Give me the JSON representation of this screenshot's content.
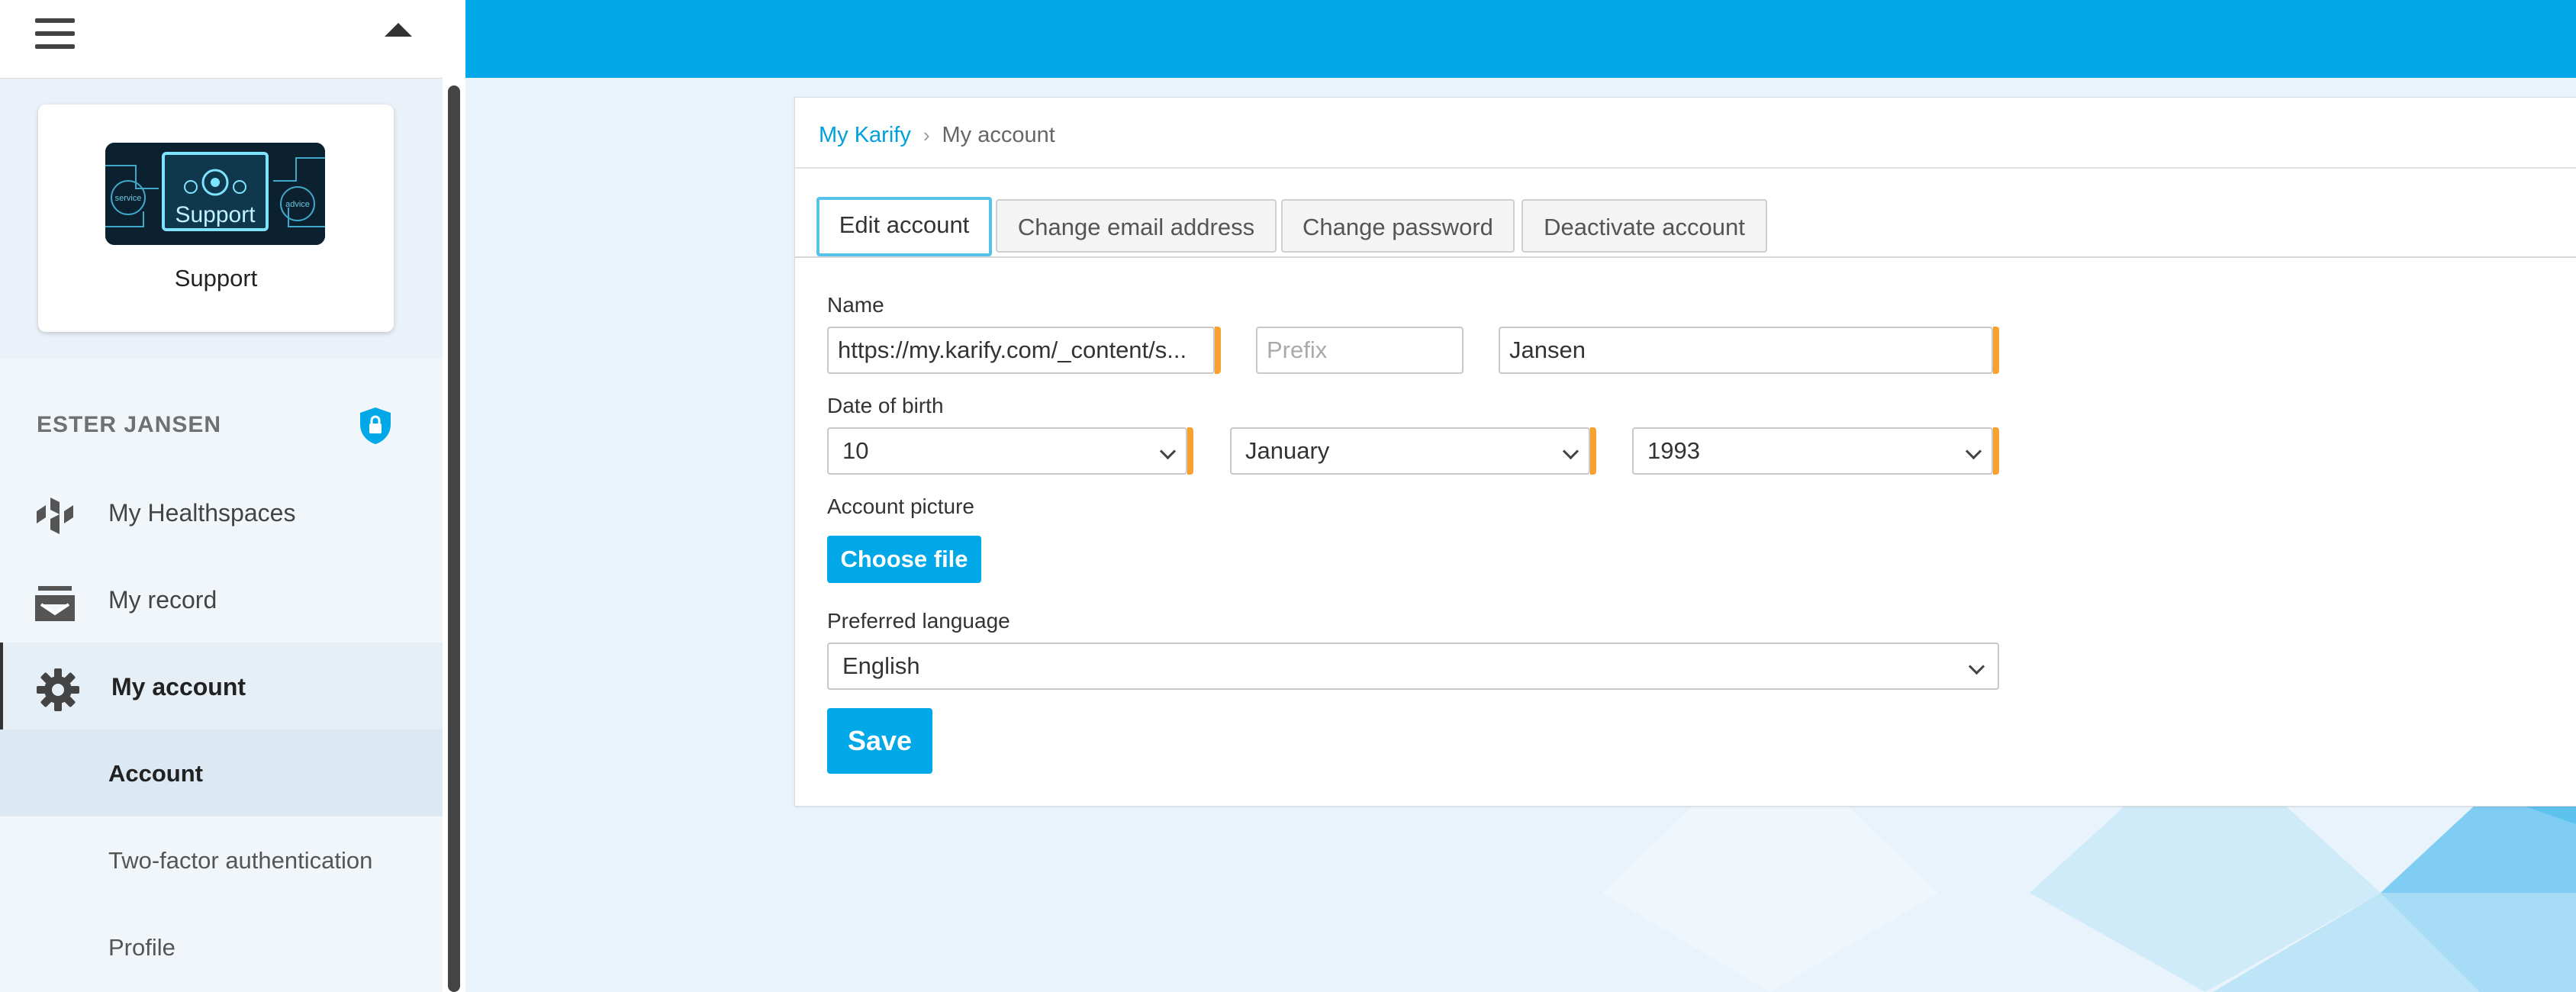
{
  "sidebar": {
    "support_card": {
      "name": "Support",
      "logo_text": "Support",
      "logo_small_left": "service",
      "logo_small_right": "advice"
    },
    "user": {
      "name": "ESTER JANSEN"
    },
    "nav": [
      {
        "label": "My Healthspaces",
        "icon": "healthspaces-icon"
      },
      {
        "label": "My record",
        "icon": "inbox-icon"
      },
      {
        "label": "My account",
        "icon": "gear-icon"
      }
    ],
    "subnav": [
      {
        "label": "Account"
      },
      {
        "label": "Two-factor authentication"
      },
      {
        "label": "Profile"
      }
    ]
  },
  "breadcrumb": {
    "root": "My Karify",
    "separator": "›",
    "current": "My account"
  },
  "tabs": [
    {
      "label": "Edit account"
    },
    {
      "label": "Change email address"
    },
    {
      "label": "Change password"
    },
    {
      "label": "Deactivate account"
    }
  ],
  "form": {
    "name_label": "Name",
    "first_name_value": "https://my.karify.com/_content/s...",
    "prefix_placeholder": "Prefix",
    "last_name_value": "Jansen",
    "dob_label": "Date of birth",
    "dob_day": "10",
    "dob_month": "January",
    "dob_year": "1993",
    "picture_label": "Account picture",
    "choose_file": "Choose file",
    "language_label": "Preferred language",
    "language_value": "English",
    "save": "Save"
  },
  "colors": {
    "primary": "#00a8e8",
    "required": "#f7a12f",
    "link": "#00a0dc"
  }
}
